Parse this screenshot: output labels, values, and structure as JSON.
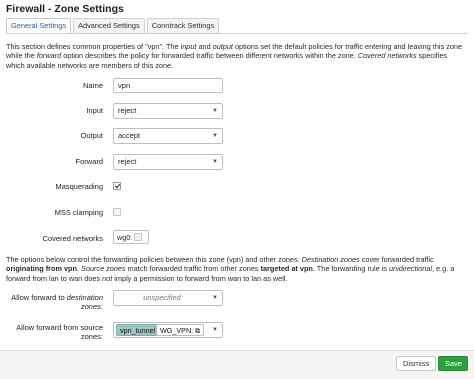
{
  "title": "Firewall - Zone Settings",
  "tabs": [
    {
      "label": "General Settings",
      "active": true
    },
    {
      "label": "Advanced Settings",
      "active": false
    },
    {
      "label": "Conntrack Settings",
      "active": false
    }
  ],
  "intro": {
    "t1": "This section defines common properties of \"vpn\". The ",
    "e1": "input",
    "t2": " and ",
    "e2": "output",
    "t3": " options set the default policies for traffic entering and leaving this zone while the ",
    "e3": "forward",
    "t4": " option describes the policy for forwarded traffic between different networks within the zone. ",
    "e4": "Covered networks",
    "t5": " specifies which available networks are members of this zone."
  },
  "fields": {
    "name": {
      "label": "Name",
      "value": "vpn"
    },
    "input": {
      "label": "Input",
      "value": "reject"
    },
    "output": {
      "label": "Output",
      "value": "accept"
    },
    "forward": {
      "label": "Forward",
      "value": "reject"
    },
    "masquerading": {
      "label": "Masquerading",
      "checked": true
    },
    "mss_clamping": {
      "label": "MSS clamping",
      "checked": false
    },
    "covered_networks": {
      "label": "Covered networks",
      "value": "wg0:"
    }
  },
  "forwarding": {
    "t1": "The options below control the forwarding policies between this zone (vpn) and other zones. ",
    "e1": "Destination zones",
    "t2": " cover forwarded traffic ",
    "b1": "originating from vpn",
    "t3": ". ",
    "e2": "Source zones",
    "t4": " match forwarded traffic from other zones ",
    "b2": "targeted at vpn",
    "t5": ". The forwarding rule is ",
    "e3": "unidirectional",
    "t6": ", e.g. a forward from lan to wan does ",
    "e4": "not",
    "t7": " imply a permission to forward from wan to lan as well."
  },
  "allow_to": {
    "label_plain": "Allow forward to ",
    "label_em": "destination zones",
    "label_end": ":",
    "placeholder": "unspecified"
  },
  "allow_from": {
    "label": "Allow forward from source zones:",
    "chip1": "vpn_tunnel",
    "chip2": "WG_VPN:"
  },
  "buttons": {
    "dismiss": "Dismiss",
    "save": "Save"
  },
  "colors": {
    "save": "#2e9e3e",
    "active_tab": "#1f5e9e",
    "zone_chip": "#9cc7c2"
  }
}
